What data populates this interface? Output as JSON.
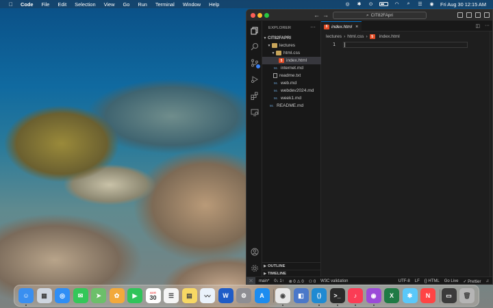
{
  "menubar": {
    "app_name": "Code",
    "items": [
      "File",
      "Edit",
      "Selection",
      "View",
      "Go",
      "Run",
      "Terminal",
      "Window",
      "Help"
    ],
    "clock": "Fri Aug 30  12:15 AM",
    "status_icons": [
      "creative-cloud-icon",
      "bluetooth-icon",
      "screen-record-icon",
      "battery-icon",
      "wifi-icon",
      "search-icon",
      "control-center-icon",
      "siri-icon"
    ]
  },
  "window": {
    "search_text": "CIT82FApri",
    "tab": {
      "label": "index.html",
      "close": "×"
    },
    "breadcrumb": [
      "lectures",
      "html.css",
      "index.html"
    ],
    "breadcrumb_sep": "›",
    "line_number": "1"
  },
  "explorer": {
    "title": "EXPLORER",
    "more": "···",
    "root": "CIT82FAPRI",
    "rows": [
      {
        "label": "lectures",
        "kind": "folder",
        "open": true
      },
      {
        "label": "html.css",
        "kind": "folder",
        "open": true
      },
      {
        "label": "index.html",
        "kind": "html",
        "selected": true
      },
      {
        "label": "internet.md",
        "kind": "md"
      },
      {
        "label": "readme.txt",
        "kind": "txt"
      },
      {
        "label": "web.md",
        "kind": "md"
      },
      {
        "label": "webdev2024.md",
        "kind": "md"
      },
      {
        "label": "week1.md",
        "kind": "md"
      },
      {
        "label": "README.md",
        "kind": "md"
      }
    ],
    "outline": "OUTLINE",
    "timeline": "TIMELINE"
  },
  "statusbar": {
    "branch": "main*",
    "sync": "0↓ 1↑",
    "problems": "⊗ 0 ⚠ 0",
    "ports": "⚇ 0",
    "w3c": "W3C validation",
    "encoding": "UTF-8",
    "eol": "LF",
    "language": "{} HTML",
    "golive": "Go Live",
    "prettier": "✓ Prettier"
  },
  "dock": {
    "apps": [
      {
        "name": "Finder",
        "color": "#3a8ff0",
        "glyph": "☺"
      },
      {
        "name": "Launchpad",
        "color": "#cfd6e0",
        "glyph": "▦"
      },
      {
        "name": "Safari",
        "color": "#2f8ef5",
        "glyph": "◎"
      },
      {
        "name": "Messages",
        "color": "#34c759",
        "glyph": "✉"
      },
      {
        "name": "Maps",
        "color": "#6cbf6a",
        "glyph": "➤"
      },
      {
        "name": "Photos",
        "color": "#f2a93b",
        "glyph": "✿"
      },
      {
        "name": "FaceTime",
        "color": "#30c45a",
        "glyph": "▶"
      },
      {
        "name": "Calendar",
        "color": "#ffffff",
        "glyph": "30"
      },
      {
        "name": "Reminders",
        "color": "#f5f5f5",
        "glyph": "☰"
      },
      {
        "name": "Notes",
        "color": "#f7d864",
        "glyph": "▤"
      },
      {
        "name": "Freeform",
        "color": "#eaf2fb",
        "glyph": "〰"
      },
      {
        "name": "Word",
        "color": "#1f5cc7",
        "glyph": "W"
      },
      {
        "name": "System Settings",
        "color": "#8e8e93",
        "glyph": "⚙"
      },
      {
        "name": "App Store",
        "color": "#1c8cf0",
        "glyph": "A"
      },
      {
        "name": "Chrome",
        "color": "#e8e8e8",
        "glyph": "◉"
      },
      {
        "name": "Preview",
        "color": "#4a78c9",
        "glyph": "◧"
      },
      {
        "name": "VS Code",
        "color": "#1f8ad2",
        "glyph": "⟨⟩"
      },
      {
        "name": "Terminal",
        "color": "#2a2a2a",
        "glyph": ">_"
      },
      {
        "name": "Music",
        "color": "#fa3c55",
        "glyph": "♪"
      },
      {
        "name": "Podcasts",
        "color": "#9b4bd8",
        "glyph": "◉"
      },
      {
        "name": "Excel",
        "color": "#1e7a45",
        "glyph": "X"
      },
      {
        "name": "Pinwheel",
        "color": "#5ac8fa",
        "glyph": "✱"
      },
      {
        "name": "News",
        "color": "#f44",
        "glyph": "N"
      },
      {
        "name": "Screen",
        "color": "#3b3b3b",
        "glyph": "▭"
      },
      {
        "name": "Trash",
        "color": "#b5b5b5",
        "glyph": "🗑"
      }
    ],
    "calendar_month": "AUG"
  }
}
